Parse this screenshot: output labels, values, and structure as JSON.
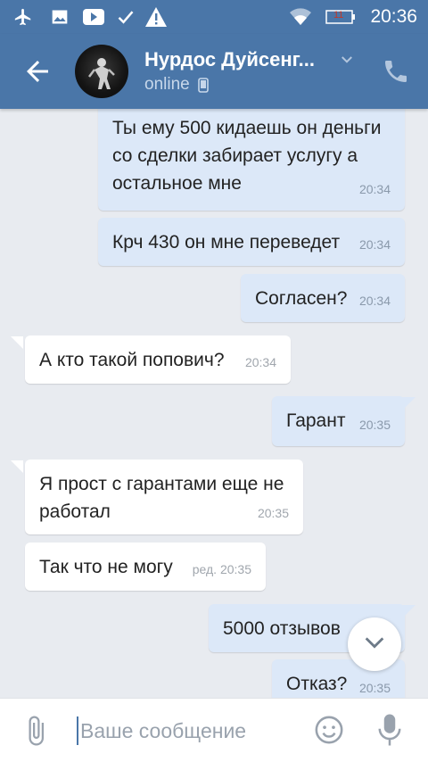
{
  "status_bar": {
    "time": "20:36",
    "battery_level": "11",
    "icons": [
      "airplane-icon",
      "image-icon",
      "youtube-icon",
      "check-icon",
      "warning-icon",
      "wifi-icon",
      "battery-icon"
    ]
  },
  "header": {
    "contact_name": "Нурдос Дуйсенг...",
    "status": "online",
    "icons": [
      "back-arrow-icon",
      "chevron-down-icon",
      "mobile-icon",
      "phone-icon"
    ]
  },
  "messages": [
    {
      "direction": "out",
      "text": "Ты ему 500 кидаешь он деньги со сделки забирает услугу а остальное мне",
      "time": "20:34"
    },
    {
      "direction": "out",
      "text": "Крч 430 он мне переведет",
      "time": "20:34"
    },
    {
      "direction": "out",
      "text": "Согласен?",
      "time": "20:34"
    },
    {
      "direction": "in",
      "text": "А кто такой попович?",
      "time": "20:34"
    },
    {
      "direction": "out",
      "text": "Гарант",
      "time": "20:35"
    },
    {
      "direction": "in",
      "text": "Я прост с гарантами еще не работал",
      "time": "20:35"
    },
    {
      "direction": "in",
      "text": "Так что не могу",
      "time": "ред. 20:35"
    },
    {
      "direction": "out",
      "text": "5000 отзывов",
      "time": ""
    },
    {
      "direction": "out",
      "text": "Отказ?",
      "time": "20:35"
    }
  ],
  "composer": {
    "placeholder": "Ваше сообщение",
    "icons": [
      "paperclip-icon",
      "emoji-icon",
      "microphone-icon"
    ]
  },
  "scroll_button": {
    "icon": "chevron-down-icon"
  },
  "colors": {
    "header_bg": "#4a76a8",
    "chat_bg": "#e8ebf0",
    "outgoing_bubble": "#dce8f8",
    "incoming_bubble": "#ffffff",
    "time_text": "#8a99ab"
  }
}
